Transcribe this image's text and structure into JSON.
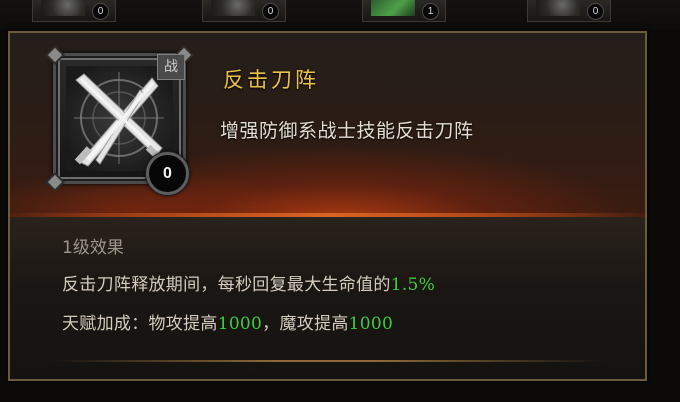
{
  "slots": [
    {
      "count": "0",
      "selected": false
    },
    {
      "count": "0",
      "selected": false
    },
    {
      "count": "1",
      "selected": true
    },
    {
      "count": "0",
      "selected": false
    }
  ],
  "skill": {
    "name": "反击刀阵",
    "class_badge": "战",
    "level": "0",
    "description": "增强防御系战士技能反击刀阵",
    "icon": "crossed-blades-icon"
  },
  "effect": {
    "title": "1级效果",
    "line1_text": "反击刀阵释放期间，每秒回复最大生命值的",
    "line1_value": "1.5%",
    "line2_prefix": "天赋加成：物攻提高",
    "line2_value1": "1000",
    "line2_mid": "，魔攻提高",
    "line2_value2": "1000"
  },
  "colors": {
    "title_gold": "#e9c24a",
    "value_green": "#3ecb44",
    "panel_border": "#6b5a3b"
  }
}
